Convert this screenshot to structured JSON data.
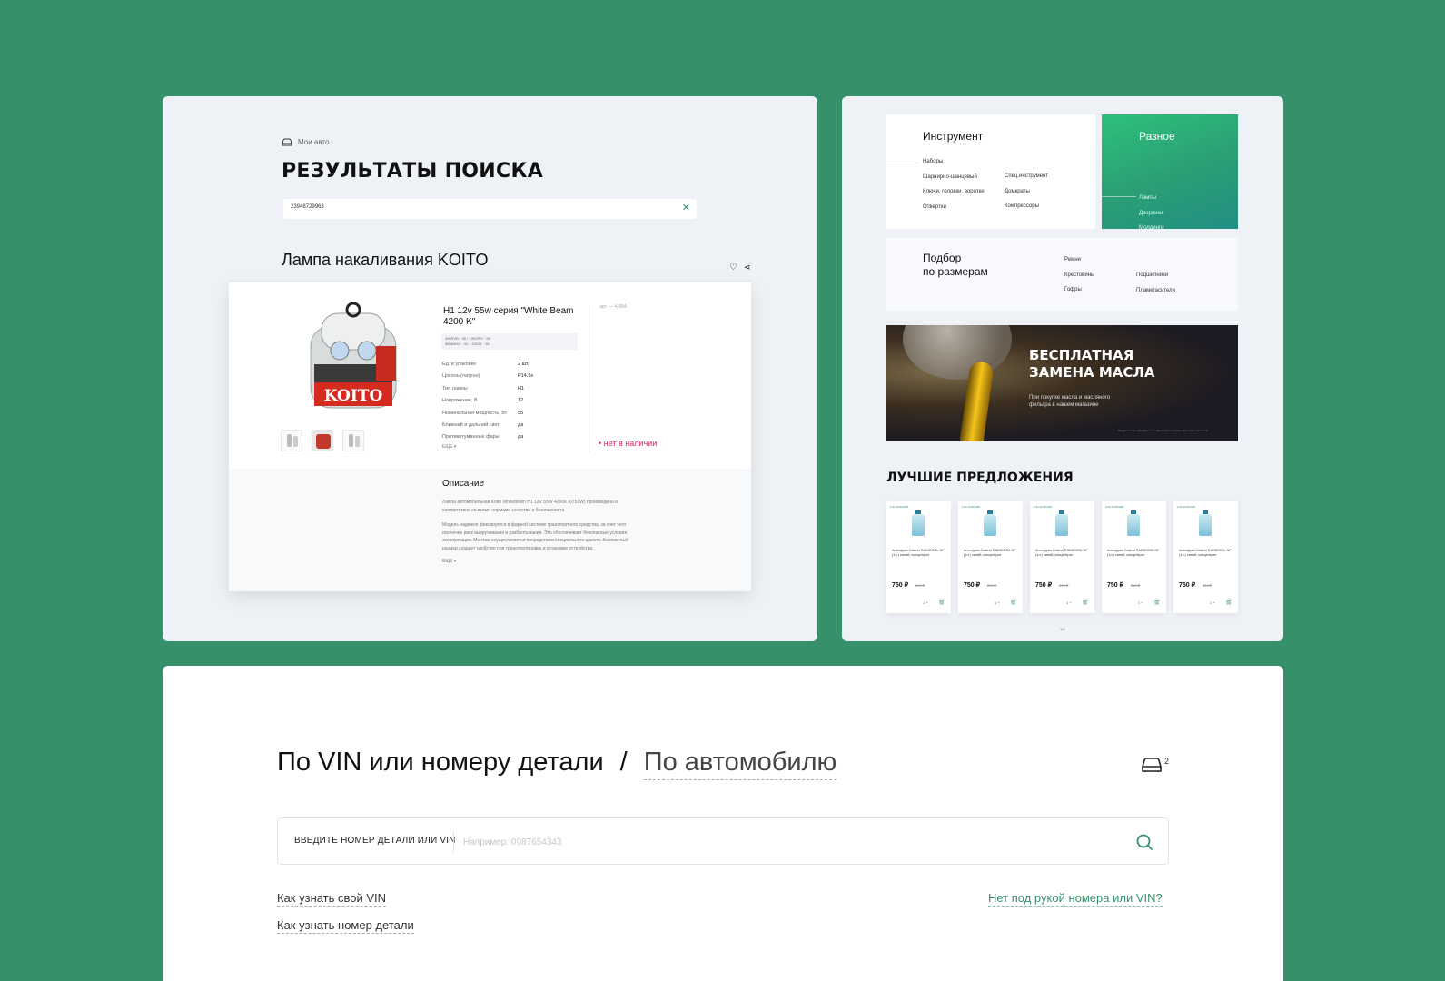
{
  "search_results": {
    "my_auto": "Мои авто",
    "title": "РЕЗУЛЬТАТЫ ПОИСКА",
    "search_value": "23948729963",
    "product_title": "Лампа накаливания KOITO",
    "product_name": "H1 12v 55w серия \"White Beam 4200 K\"",
    "tag_line1": "WHSVR · 45 / 70KOPX · 55",
    "tag_line2": "85064HO · 4C · 24126 · 18",
    "spec_labels": [
      "Ед. в упаковке",
      "Цоколь (патрон)",
      "Тип лампы",
      "Напряжение, В",
      "Номинальная мощность, Вт",
      "Ближний и дальний свет",
      "Противотуманные фары"
    ],
    "spec_values": [
      "2 шт.",
      "P14.5s",
      "H1",
      "12",
      "55",
      "да",
      "да"
    ],
    "more": "ЕЩЕ",
    "article": "арт. — 4,0BA",
    "availability": "нет в наличии",
    "description_heading": "Описание",
    "description_p1": "Лампа автомобильная Koito Whitebeam H1 12V 55W 4200К (0751W) произведена в соответствии со всеми нормами качества и безопасности.",
    "description_p2": "Модель надежно фиксируется в фарной системе транспортного средства, за счет чего исключен риск выкручивания и разбалтывания. Это обеспечивает безопасные условия эксплуатации. Монтаж осуществляется посредством специального цоколя. Компактный размер создает удобство при транспортировке и установке устройства.",
    "description_more": "ЕЩЕ"
  },
  "catalog": {
    "tools": {
      "title": "Инструмент",
      "col1": [
        "Наборы",
        "Шарнирно-шанцевый",
        "Ключи, головки, воротки",
        "Отвертки"
      ],
      "col2": [
        "Спец.инструмент",
        "Домкраты",
        "Компрессоры"
      ]
    },
    "misc": {
      "title": "Разное",
      "items": [
        "Лампы",
        "Дворники",
        "Молдинги"
      ]
    },
    "sizes": {
      "title": "Подбор\nпо размерам",
      "col1": [
        "Ремни",
        "Крестовины",
        "Гофры"
      ],
      "col2": [
        "Подшипники",
        "Пламегасители"
      ]
    },
    "banner": {
      "title": "БЕСПЛАТНАЯ\nЗАМЕНА МАСЛА",
      "subtitle": "При покупке масла и масляного\nфильтра в нашем магазине",
      "footnote": "Предложение действительно при покупке масла и фильтра в магазине"
    },
    "best_offers_title": "ЛУЧШИЕ ПРЕДЛОЖЕНИЯ",
    "offers": [
      {
        "badge": "● В НАЛИЧИИ",
        "name": "Антифриз Castrol RADICOOL NF (1л.) синий, концентрат",
        "price": "750 ₽",
        "old_price": "810 ₽",
        "qty": "1 +"
      },
      {
        "badge": "● В НАЛИЧИИ",
        "name": "Антифриз Castrol RADICOOL NF (1л.) синий, концентрат",
        "price": "750 ₽",
        "old_price": "810 ₽",
        "qty": "1 +"
      },
      {
        "badge": "● В НАЛИЧИИ",
        "name": "Антифриз Castrol RADICOOL NF (1л.) синий, концентрат",
        "price": "750 ₽",
        "old_price": "810 ₽",
        "qty": "1 +"
      },
      {
        "badge": "● В НАЛИЧИИ",
        "name": "Антифриз Castrol RADICOOL NF (1л.) синий, концентрат",
        "price": "750 ₽",
        "old_price": "810 ₽",
        "qty": "1 +"
      },
      {
        "badge": "● В НАЛИЧИИ",
        "name": "Антифриз Castrol RADICOOL NF (1л.) синий, концентрат",
        "price": "750 ₽",
        "old_price": "810 ₽",
        "qty": "1 +"
      }
    ],
    "pager": "1/2"
  },
  "vin_search": {
    "tab_active": "По VIN или номеру детали",
    "separator": "/",
    "tab_inactive": "По автомобилю",
    "garage_count": "2",
    "field_label": "ВВЕДИТЕ НОМЕР ДЕТАЛИ ИЛИ VIN",
    "placeholder": "Например: 0987654343",
    "link_vin": "Как узнать свой VIN",
    "link_part": "Как узнать номер детали",
    "link_no_number": "Нет под рукой номера или VIN?"
  },
  "colors": {
    "background": "#36916b",
    "accent": "#36916b",
    "out_of_stock": "#e0245e"
  }
}
